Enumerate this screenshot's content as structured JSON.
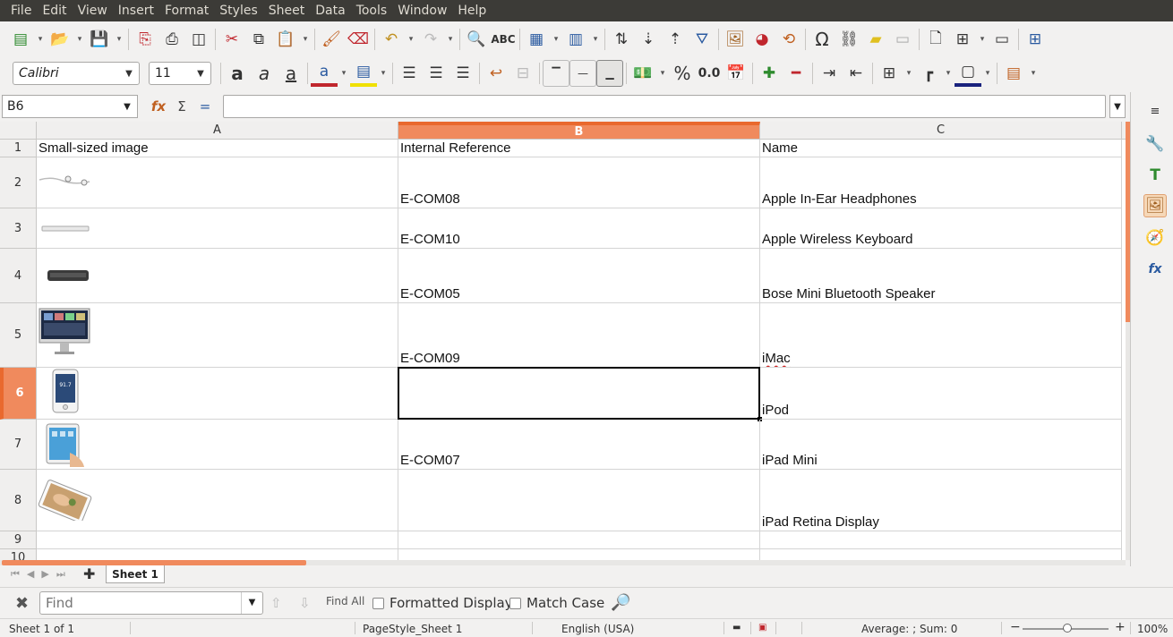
{
  "menu": [
    "File",
    "Edit",
    "View",
    "Insert",
    "Format",
    "Styles",
    "Sheet",
    "Data",
    "Tools",
    "Window",
    "Help"
  ],
  "font": {
    "name": "Calibri",
    "size": "11"
  },
  "namebox": "B6",
  "formula": "",
  "columns": [
    "A",
    "B",
    "C"
  ],
  "headers": {
    "a": "Small-sized image",
    "b": "Internal Reference",
    "c": "Name"
  },
  "rows": [
    {
      "num": "1"
    },
    {
      "num": "2",
      "ref": "E-COM08",
      "name": "Apple In-Ear Headphones"
    },
    {
      "num": "3",
      "ref": "E-COM10",
      "name": "Apple Wireless Keyboard"
    },
    {
      "num": "4",
      "ref": "E-COM05",
      "name": "Bose Mini Bluetooth Speaker"
    },
    {
      "num": "5",
      "ref": "E-COM09",
      "name": "iMac"
    },
    {
      "num": "6",
      "ref": "",
      "name": "iPod"
    },
    {
      "num": "7",
      "ref": "E-COM07",
      "name": "iPad Mini"
    },
    {
      "num": "8",
      "ref": "",
      "name": "iPad Retina Display"
    },
    {
      "num": "9"
    },
    {
      "num": "10"
    }
  ],
  "sheet_tab": "Sheet 1",
  "find": {
    "placeholder": "Find",
    "find_all": "Find All",
    "formatted_display": "Formatted Display",
    "match_case": "Match Case"
  },
  "status": {
    "sheet": "Sheet 1 of 1",
    "page_style": "PageStyle_Sheet 1",
    "language": "English (USA)",
    "summary": "Average: ; Sum: 0",
    "zoom": "100%"
  },
  "colors": {
    "accent": "#f08a5d",
    "menubar": "#3c3b37"
  }
}
